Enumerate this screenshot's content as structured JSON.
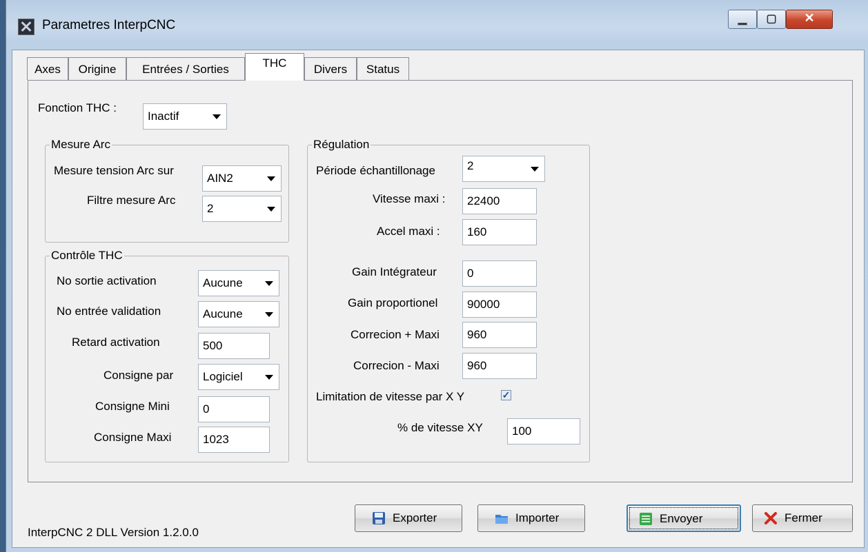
{
  "window": {
    "title": "Parametres InterpCNC"
  },
  "tabs": [
    {
      "label": "Axes"
    },
    {
      "label": "Origine"
    },
    {
      "label": "Entrées / Sorties"
    },
    {
      "label": "THC"
    },
    {
      "label": "Divers"
    },
    {
      "label": "Status"
    }
  ],
  "fonction_thc": {
    "label": "Fonction THC :",
    "value": "Inactif"
  },
  "mesure_arc": {
    "title": "Mesure Arc",
    "tension_label": "Mesure tension Arc sur",
    "tension_value": "AIN2",
    "filtre_label": "Filtre mesure Arc",
    "filtre_value": "2"
  },
  "controle_thc": {
    "title": "Contrôle THC",
    "sortie_label": "No sortie activation",
    "sortie_value": "Aucune",
    "entree_label": "No entrée validation",
    "entree_value": "Aucune",
    "retard_label": "Retard activation",
    "retard_value": "500",
    "consigne_par_label": "Consigne par",
    "consigne_par_value": "Logiciel",
    "consigne_mini_label": "Consigne Mini",
    "consigne_mini_value": "0",
    "consigne_maxi_label": "Consigne Maxi",
    "consigne_maxi_value": "1023"
  },
  "regulation": {
    "title": "Régulation",
    "periode_label": "Période échantillonage",
    "periode_value": "2",
    "vitesse_label": "Vitesse maxi :",
    "vitesse_value": "22400",
    "accel_label": "Accel maxi :",
    "accel_value": "160",
    "gain_int_label": "Gain Intégrateur",
    "gain_int_value": "0",
    "gain_prop_label": "Gain proportionel",
    "gain_prop_value": "90000",
    "corr_plus_label": "Correcion + Maxi",
    "corr_plus_value": "960",
    "corr_minus_label": "Correcion - Maxi",
    "corr_minus_value": "960",
    "limitation_label": "Limitation de vitesse par X Y",
    "limitation_checked": true,
    "pct_label": "% de vitesse XY",
    "pct_value": "100"
  },
  "footer": {
    "version": "InterpCNC 2 DLL Version 1.2.0.0",
    "exporter": "Exporter",
    "importer": "Importer",
    "envoyer": "Envoyer",
    "fermer": "Fermer"
  }
}
